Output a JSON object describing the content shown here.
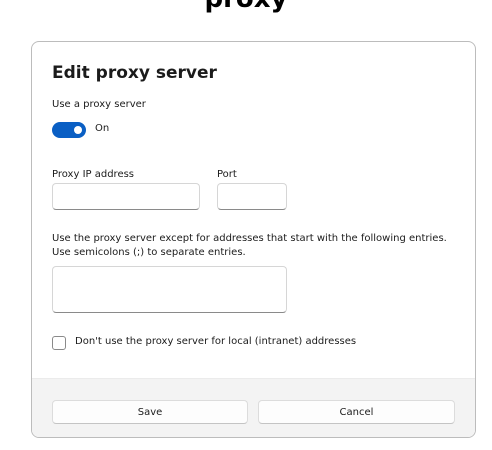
{
  "page": {
    "heading": "proxy"
  },
  "dialog": {
    "title": "Edit proxy server",
    "use_proxy_label": "Use a proxy server",
    "toggle": {
      "state_label": "On",
      "on": true
    },
    "proxy_ip": {
      "label": "Proxy IP address",
      "value": ""
    },
    "port": {
      "label": "Port",
      "value": ""
    },
    "exceptions": {
      "description_line1": "Use the proxy server except for addresses that start with the following entries.",
      "description_line2": "Use semicolons (;) to separate entries.",
      "value": ""
    },
    "local_bypass": {
      "label": "Don't use the proxy server for local (intranet) addresses",
      "checked": false
    },
    "buttons": {
      "save": "Save",
      "cancel": "Cancel"
    }
  },
  "colors": {
    "accent": "#0a5fc4",
    "footer_bg": "#f3f3f3",
    "border": "#bcbcbc"
  }
}
